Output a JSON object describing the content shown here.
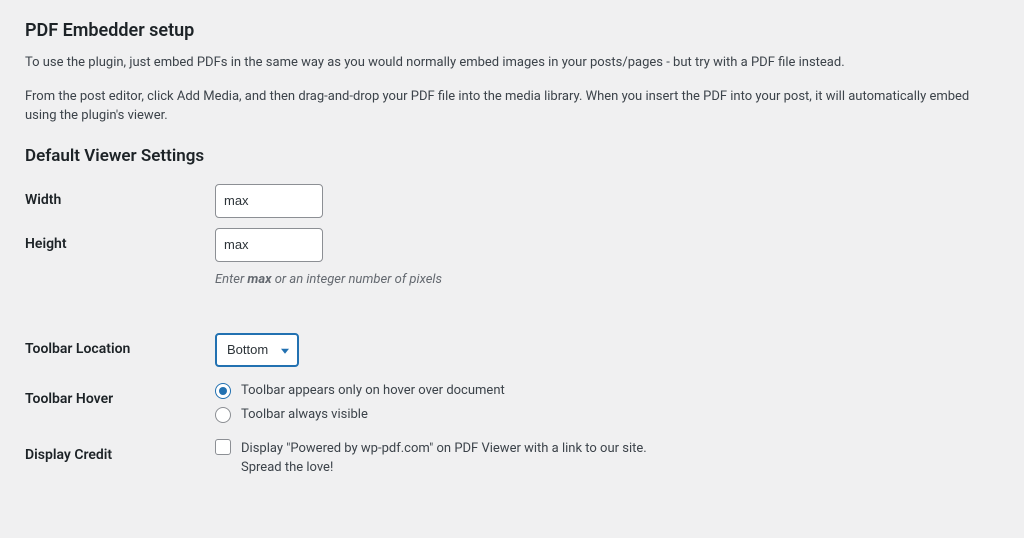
{
  "header": {
    "title": "PDF Embedder setup",
    "intro1": "To use the plugin, just embed PDFs in the same way as you would normally embed images in your posts/pages - but try with a PDF file instead.",
    "intro2": "From the post editor, click Add Media, and then drag-and-drop your PDF file into the media library. When you insert the PDF into your post, it will automatically embed using the plugin's viewer."
  },
  "section": {
    "title": "Default Viewer Settings"
  },
  "fields": {
    "width": {
      "label": "Width",
      "value": "max"
    },
    "height": {
      "label": "Height",
      "value": "max",
      "hint_prefix": "Enter ",
      "hint_bold": "max",
      "hint_suffix": " or an integer number of pixels"
    },
    "toolbar_location": {
      "label": "Toolbar Location",
      "selected": "Bottom"
    },
    "toolbar_hover": {
      "label": "Toolbar Hover",
      "options": [
        "Toolbar appears only on hover over document",
        "Toolbar always visible"
      ]
    },
    "display_credit": {
      "label": "Display Credit",
      "text": "Display \"Powered by wp-pdf.com\" on PDF Viewer with a link to our site. Spread the love!"
    }
  }
}
